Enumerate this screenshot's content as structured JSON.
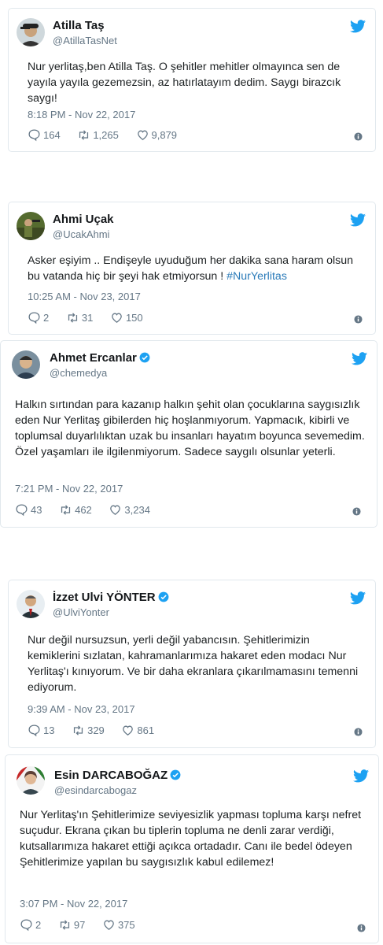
{
  "tweets": [
    {
      "name": "Atilla Taş",
      "handle": "@AtillaTasNet",
      "verified": false,
      "text": "Nur yerlitaş,ben Atilla Taş. O şehitler mehitler olmayınca sen de yayıla yayıla gezemezsin, az hatırlatayım dedim. Saygı birazcık saygı!",
      "hashtag": "",
      "time": "8:18 PM - Nov 22, 2017",
      "replies": "164",
      "retweets": "1,265",
      "likes": "9,879",
      "avatar_icon": "avatar-cap-man-icon"
    },
    {
      "name": "Ahmi Uçak",
      "handle": "@UcakAhmi",
      "verified": false,
      "text": "Asker eşiyim .. Endişeyle uyuduğum her dakika sana haram olsun bu vatanda hiç bir şeyi hak etmiyorsun !",
      "hashtag": "#NurYerlitas",
      "time": "10:25 AM - Nov 23, 2017",
      "replies": "2",
      "retweets": "31",
      "likes": "150",
      "avatar_icon": "avatar-soldier-icon"
    },
    {
      "name": "Ahmet Ercanlar",
      "handle": "@chemedya",
      "verified": true,
      "text": "Halkın sırtından para kazanıp halkın şehit olan çocuklarına saygısızlık eden Nur Yerlitaş gibilerden hiç hoşlanmıyorum. Yapmacık, kibirli ve toplumsal duyarlılıktan uzak bu insanları hayatım boyunca sevemedim. Özel yaşamları ile ilgilenmiyorum. Sadece saygılı olsunlar yeterli.",
      "hashtag": "",
      "time": "7:21 PM - Nov 22, 2017",
      "replies": "43",
      "retweets": "462",
      "likes": "3,234",
      "avatar_icon": "avatar-man-icon"
    },
    {
      "name": "İzzet Ulvi YÖNTER",
      "handle": "@UlviYonter",
      "verified": true,
      "text": "Nur değil nursuzsun, yerli değil yabancısın. Şehitlerimizin kemiklerini sızlatan, kahramanlarımıza hakaret eden modacı Nur Yerlitaş'ı kınıyorum. Ve bir daha ekranlara çıkarılmamasını temenni ediyorum.",
      "hashtag": "",
      "time": "9:39 AM - Nov 23, 2017",
      "replies": "13",
      "retweets": "329",
      "likes": "861",
      "avatar_icon": "avatar-suit-man-icon"
    },
    {
      "name": "Esin DARCABOĞAZ",
      "handle": "@esindarcabogaz",
      "verified": true,
      "text": "Nur Yerlitaş'ın Şehitlerimize seviyesizlik yapması topluma karşı nefret suçudur. Ekrana çıkan bu tiplerin topluma ne denli zarar verdiği, kutsallarımıza hakaret ettiği açıkca ortadadır. Canı ile bedel ödeyen Şehitlerimize yapılan bu saygısızlık kabul edilemez!",
      "hashtag": "",
      "time": "3:07 PM - Nov 22, 2017",
      "replies": "2",
      "retweets": "97",
      "likes": "375",
      "avatar_icon": "avatar-woman-icon"
    }
  ],
  "colors": {
    "accent": "#1da1f2",
    "hashtag": "#2b7bb9",
    "muted": "#657786",
    "border": "#e1e8ed"
  }
}
